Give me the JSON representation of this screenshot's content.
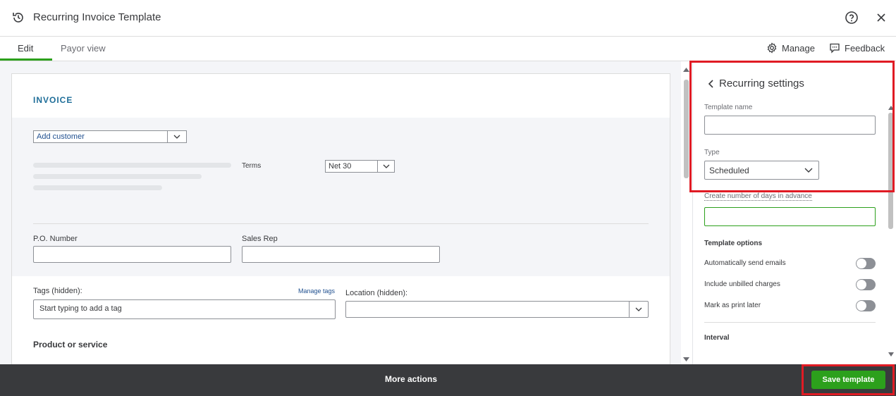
{
  "window": {
    "title": "Recurring Invoice Template"
  },
  "tabs": [
    {
      "label": "Edit",
      "active": true
    },
    {
      "label": "Payor view",
      "active": false
    }
  ],
  "toolbar": {
    "manage_label": "Manage",
    "feedback_label": "Feedback"
  },
  "invoice": {
    "title": "INVOICE",
    "customer_select": "Add customer",
    "terms_label": "Terms",
    "terms_value": "Net 30",
    "po_label": "P.O. Number",
    "sales_rep_label": "Sales Rep",
    "tags_label": "Tags (hidden):",
    "manage_tags": "Manage tags",
    "tags_placeholder": "Start typing to add a tag",
    "location_label": "Location (hidden):",
    "product_heading": "Product or service"
  },
  "recurring_panel": {
    "title": "Recurring settings",
    "template_name_label": "Template name",
    "template_name_value": "",
    "type_label": "Type",
    "type_value": "Scheduled",
    "days_label": "Create number of days in advance",
    "days_value": "",
    "options_heading": "Template options",
    "options": [
      {
        "label": "Automatically send emails",
        "on": false
      },
      {
        "label": "Include unbilled charges",
        "on": false
      },
      {
        "label": "Mark as print later",
        "on": false
      }
    ],
    "interval_heading": "Interval"
  },
  "footer": {
    "more_actions": "More actions",
    "save_template": "Save template"
  },
  "colors": {
    "accent_green": "#2ca01c",
    "highlight_red": "#e01b24",
    "footer_bg": "#393a3d",
    "link_blue": "#1f6e99"
  }
}
